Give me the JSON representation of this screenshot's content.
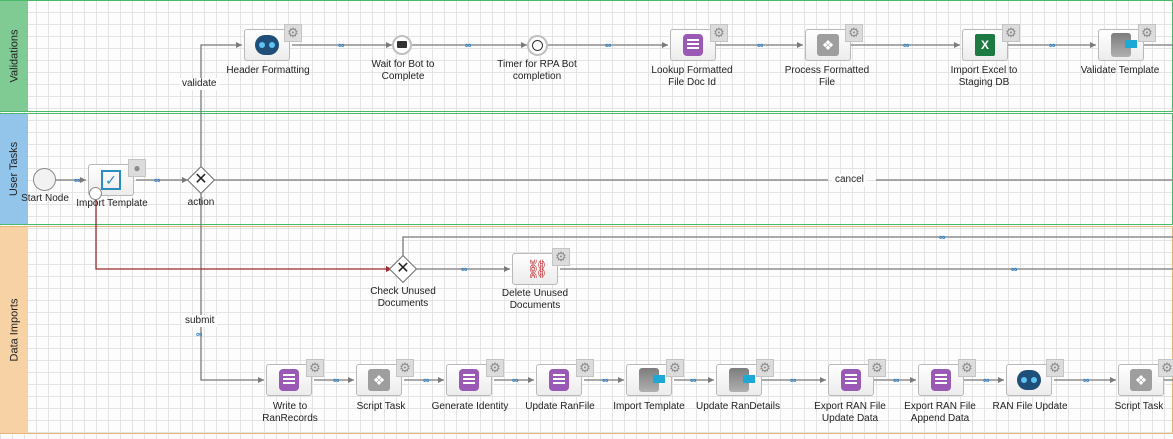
{
  "lanes": {
    "validations": "Validations",
    "user_tasks": "User Tasks",
    "data_imports": "Data Imports"
  },
  "colors": {
    "validations": "#7fcb93",
    "user_tasks": "#93c5ea",
    "data_imports": "#f6d2a5",
    "lane_border_green": "#49b96a",
    "lane_border_orange": "#e5b57a",
    "flow": "#7a7a7a",
    "boundary_flow": "#9c2b2b",
    "link_icon": "#2a7fc8"
  },
  "nodes": {
    "header_formatting": "Header Formatting",
    "wait_for_bot_line1": "Wait for Bot to",
    "wait_for_bot_line2": "Complete",
    "timer_line1": "Timer for RPA Bot",
    "timer_line2": "completion",
    "lookup_line1": "Lookup Formatted",
    "lookup_line2": "File Doc Id",
    "process_line1": "Process Formatted",
    "process_line2": "File",
    "import_excel_line1": "Import Excel to",
    "import_excel_line2": "Staging DB",
    "validate_template": "Validate Template",
    "start_node": "Start Node",
    "import_template_user": "Import Template",
    "action_gateway": "action",
    "check_unused_line1": "Check Unused",
    "check_unused_line2": "Documents",
    "delete_unused_line1": "Delete Unused",
    "delete_unused_line2": "Documents",
    "write_ran_line1": "Write to",
    "write_ran_line2": "RanRecords",
    "script_task_1": "Script Task",
    "generate_identity": "Generate Identity",
    "update_ranfile": "Update RanFile",
    "import_template_data": "Import Template",
    "update_randetails": "Update RanDetails",
    "export_update_line1": "Export RAN File",
    "export_update_line2": "Update Data",
    "export_append_line1": "Export RAN File",
    "export_append_line2": "Append Data",
    "ran_file_update": "RAN File Update",
    "script_task_2": "Script Task"
  },
  "edge_labels": {
    "validate": "validate",
    "cancel": "cancel",
    "submit": "submit"
  },
  "icons": {
    "gear": "gear-icon",
    "bot": "bot-icon",
    "database": "database-icon",
    "script": "script-icon",
    "server": "server-icon",
    "excel": "excel-icon",
    "trash": "trash-icon",
    "envelope": "envelope-icon",
    "clock": "clock-icon",
    "checkbox": "checkbox-icon",
    "person": "person-icon",
    "link": "link-icon"
  }
}
